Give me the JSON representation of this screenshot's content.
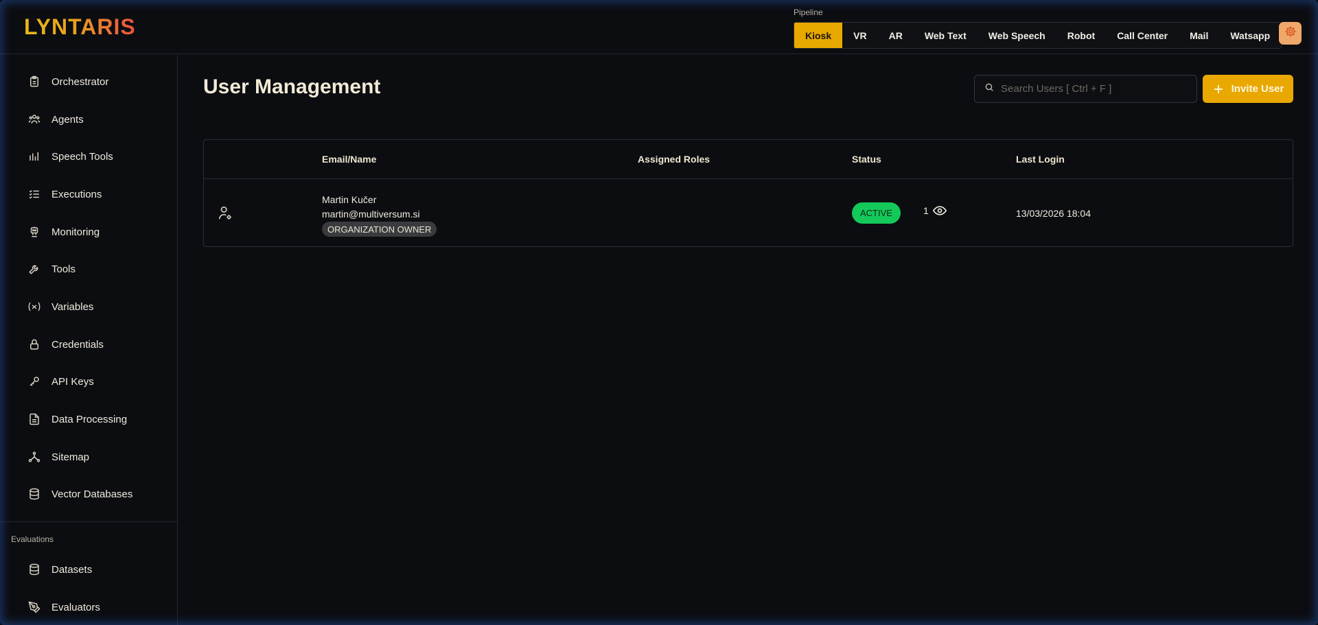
{
  "brand": {
    "logo_text": "LYNTARIS"
  },
  "pipeline": {
    "label": "Pipeline",
    "tabs": [
      "Kiosk",
      "VR",
      "AR",
      "Web Text",
      "Web Speech",
      "Robot",
      "Call Center",
      "Mail",
      "Watsapp"
    ],
    "active": "Kiosk"
  },
  "sidebar": {
    "items": [
      {
        "label": "Orchestrator",
        "icon": "clipboard-icon"
      },
      {
        "label": "Agents",
        "icon": "users-icon"
      },
      {
        "label": "Speech Tools",
        "icon": "bar-chart-icon"
      },
      {
        "label": "Executions",
        "icon": "list-check-icon"
      },
      {
        "label": "Monitoring",
        "icon": "robot-icon"
      },
      {
        "label": "Tools",
        "icon": "wrench-icon"
      },
      {
        "label": "Variables",
        "icon": "variable-icon"
      },
      {
        "label": "Credentials",
        "icon": "lock-icon"
      },
      {
        "label": "API Keys",
        "icon": "key-icon"
      },
      {
        "label": "Data Processing",
        "icon": "file-icon"
      },
      {
        "label": "Sitemap",
        "icon": "network-icon"
      },
      {
        "label": "Vector Databases",
        "icon": "database-icon"
      }
    ],
    "evaluations_label": "Evaluations",
    "eval_items": [
      {
        "label": "Datasets",
        "icon": "database-icon"
      },
      {
        "label": "Evaluators",
        "icon": "pen-tool-icon"
      }
    ]
  },
  "main": {
    "title": "User Management",
    "search_placeholder": "Search Users [ Ctrl + F ]",
    "invite_label": "Invite User",
    "columns": [
      "Email/Name",
      "Assigned Roles",
      "Status",
      "Last Login"
    ],
    "rows": [
      {
        "name": "Martin Kučer",
        "email": "martin@multiversum.si",
        "badge": "ORGANIZATION OWNER",
        "roles": "1",
        "status": "ACTIVE",
        "last_login": "13/03/2026 18:04"
      }
    ]
  },
  "colors": {
    "accent": "#e9a800",
    "background": "#0b0d11",
    "status_active": "#13c95a"
  }
}
